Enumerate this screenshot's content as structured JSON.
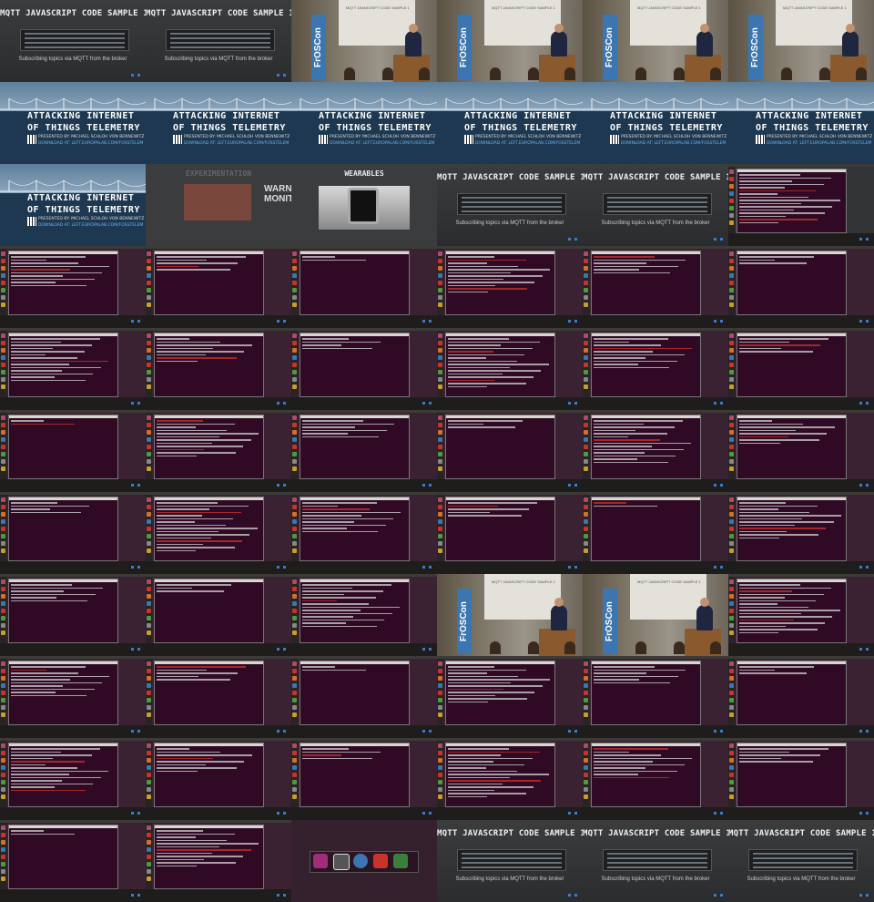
{
  "sheet": {
    "columns": 6,
    "rows": 11,
    "tiles": [
      "slide",
      "slide",
      "photo",
      "photo",
      "photo",
      "photo",
      "title",
      "title",
      "title",
      "title",
      "title",
      "title",
      "title",
      "experiment",
      "wearables",
      "slide",
      "slide",
      "slide-terminal",
      "terminal",
      "terminal",
      "terminal",
      "terminal",
      "terminal",
      "terminal",
      "terminal",
      "terminal",
      "terminal",
      "terminal",
      "terminal",
      "terminal",
      "terminal",
      "terminal",
      "terminal",
      "terminal",
      "terminal",
      "terminal",
      "terminal",
      "terminal",
      "terminal",
      "terminal",
      "terminal",
      "terminal",
      "terminal",
      "terminal",
      "terminal",
      "photo",
      "photo",
      "terminal",
      "terminal",
      "terminal",
      "terminal",
      "terminal",
      "terminal",
      "terminal",
      "terminal",
      "terminal",
      "terminal",
      "terminal",
      "terminal",
      "terminal",
      "terminal",
      "terminal",
      "launcher",
      "slide",
      "slide",
      "slide"
    ]
  },
  "slide": {
    "title": "MQTT JAVASCRIPT CODE SAMPLE 1",
    "subtitle": "Subscribing topics via MQTT from the broker"
  },
  "title_slide": {
    "line1": "ATTACKING INTERNET",
    "line2": "OF THINGS TELEMETRY",
    "presented_by": "PRESENTED BY: MICHAEL SCHLOH VON BENNEWITZ",
    "download": "DOWNLOAD AT: LEFT.EUROPALAB.COM/FOSSTELEM"
  },
  "experiment": {
    "title": "EXPERIMENTATION",
    "side": "WARNI MONITO"
  },
  "wearables": {
    "title": "WEARABLES"
  },
  "photo": {
    "banner": "FrOSCon",
    "screen_title": "MQTT JAVASCRIPT CODE SAMPLE 1"
  },
  "colors": {
    "terminal_bg": "#300a24",
    "slide_bg": "#323436",
    "title_bg": "#1d3850",
    "accent_blue": "#3c7bc8",
    "banner_blue": "#3b76b0"
  }
}
